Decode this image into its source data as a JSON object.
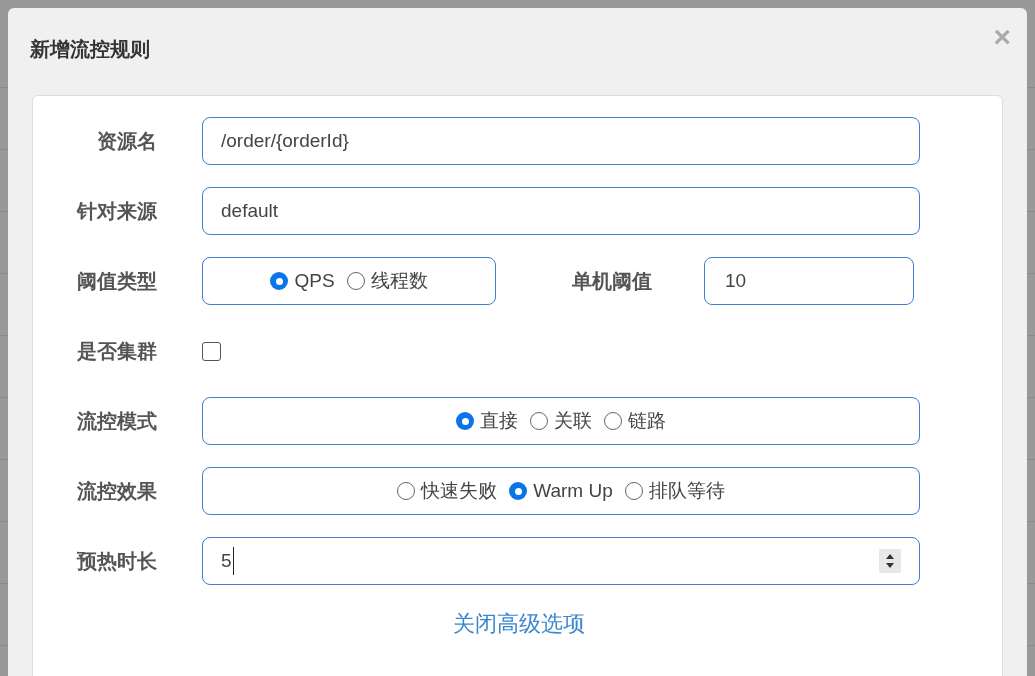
{
  "dialog": {
    "title": "新增流控规则",
    "close": "×"
  },
  "form": [
    {
      "kind": "text",
      "label": "资源名",
      "value": "/order/{orderId}"
    },
    {
      "kind": "text",
      "label": "针对来源",
      "value": "default"
    },
    {
      "kind": "threshold",
      "label": "阈值类型",
      "options": [
        {
          "label": "QPS",
          "selected": true
        },
        {
          "label": "线程数",
          "selected": false
        }
      ],
      "side_label": "单机阈值",
      "side_value": "10"
    },
    {
      "kind": "checkbox",
      "label": "是否集群",
      "checked": false
    },
    {
      "kind": "radio",
      "label": "流控模式",
      "options": [
        {
          "label": "直接",
          "selected": true
        },
        {
          "label": "关联",
          "selected": false
        },
        {
          "label": "链路",
          "selected": false
        }
      ]
    },
    {
      "kind": "radio",
      "label": "流控效果",
      "options": [
        {
          "label": "快速失败",
          "selected": false
        },
        {
          "label": "Warm Up",
          "selected": true
        },
        {
          "label": "排队等待",
          "selected": false
        }
      ]
    },
    {
      "kind": "number",
      "label": "预热时长",
      "value": "5"
    }
  ],
  "advanced_link": "关闭高级选项"
}
